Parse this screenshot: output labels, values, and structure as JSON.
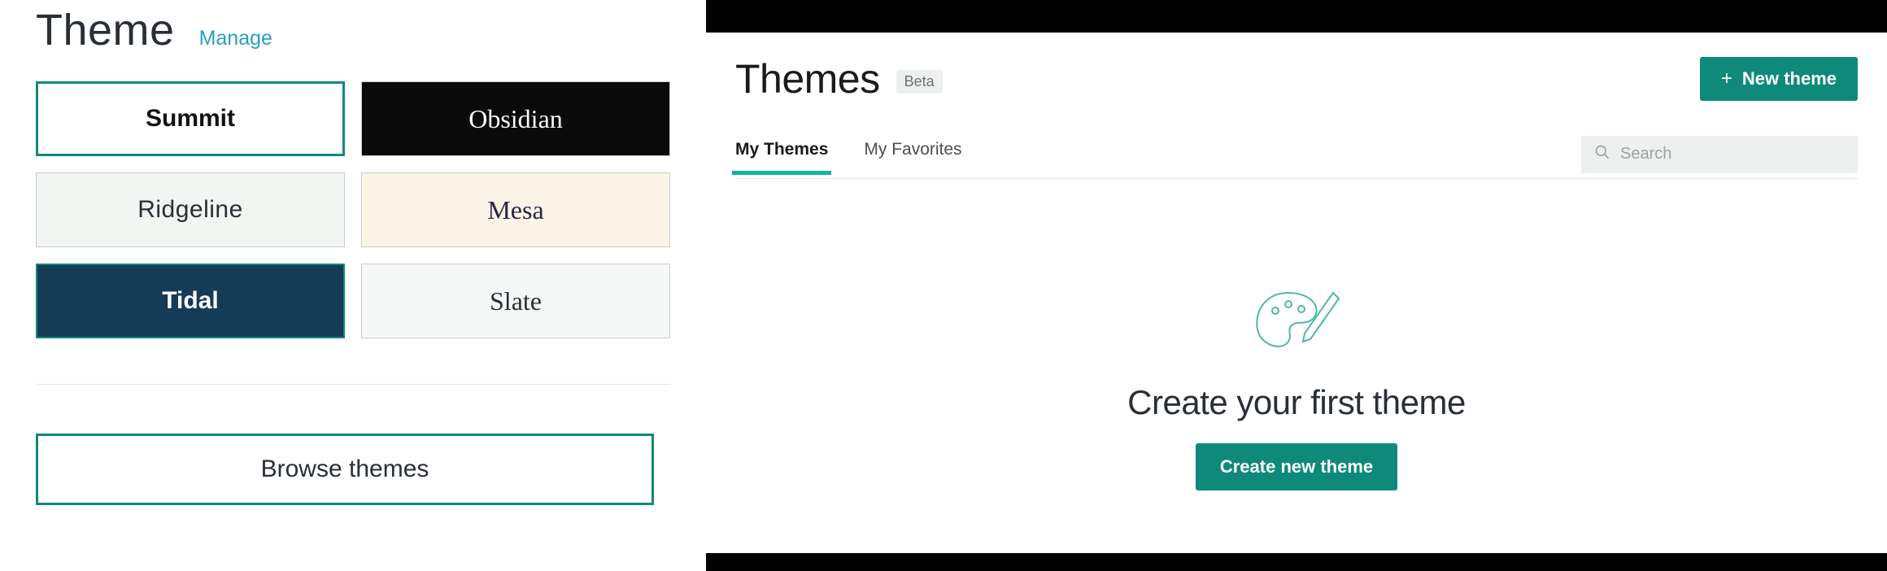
{
  "left": {
    "title": "Theme",
    "manage_link": "Manage",
    "tiles": {
      "summit": "Summit",
      "obsidian": "Obsidian",
      "ridgeline": "Ridgeline",
      "mesa": "Mesa",
      "tidal": "Tidal",
      "slate": "Slate"
    },
    "browse_button": "Browse themes"
  },
  "right": {
    "title": "Themes",
    "beta_label": "Beta",
    "new_theme_button": "New theme",
    "tabs": {
      "my_themes": "My Themes",
      "my_favorites": "My Favorites"
    },
    "search_placeholder": "Search",
    "empty": {
      "headline": "Create your first theme",
      "cta": "Create new theme"
    }
  },
  "colors": {
    "accent": "#0f8a7a",
    "accent_light": "#11b5a4"
  }
}
